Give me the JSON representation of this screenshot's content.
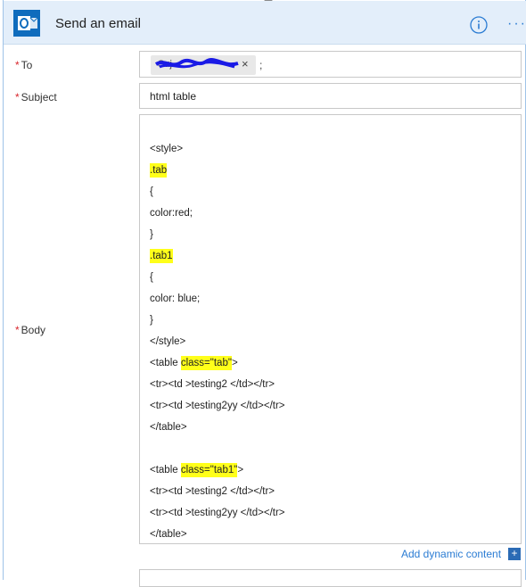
{
  "header": {
    "title": "Send an email",
    "info_icon": "info-icon",
    "more_icon": "more-options-icon",
    "more_glyph": "···"
  },
  "fields": {
    "to": {
      "label": "To",
      "token_text": "Suj",
      "token_close": "×",
      "separator": ";"
    },
    "subject": {
      "label": "Subject",
      "value": "html table"
    },
    "body": {
      "label": "Body",
      "lines": [
        "",
        "<style>",
        ".tab",
        "{",
        "color:red;",
        "}",
        ".tab1",
        "{",
        "color: blue;",
        "}",
        "</style>",
        "<table class=\"tab\">",
        "<tr><td >testing2 </td></tr>",
        "<tr><td >testing2yy </td></tr>",
        "</table>",
        "",
        "<table class=\"tab1\">",
        "<tr><td >testing2 </td></tr>",
        "<tr><td >testing2yy </td></tr>",
        "</table>"
      ]
    }
  },
  "dynamic_content": {
    "label": "Add dynamic content",
    "plus": "+"
  },
  "colors": {
    "highlight": "#ffff1a",
    "accent": "#2b7cd3",
    "required": "#d8262c",
    "header_bg": "#e3eefa"
  }
}
